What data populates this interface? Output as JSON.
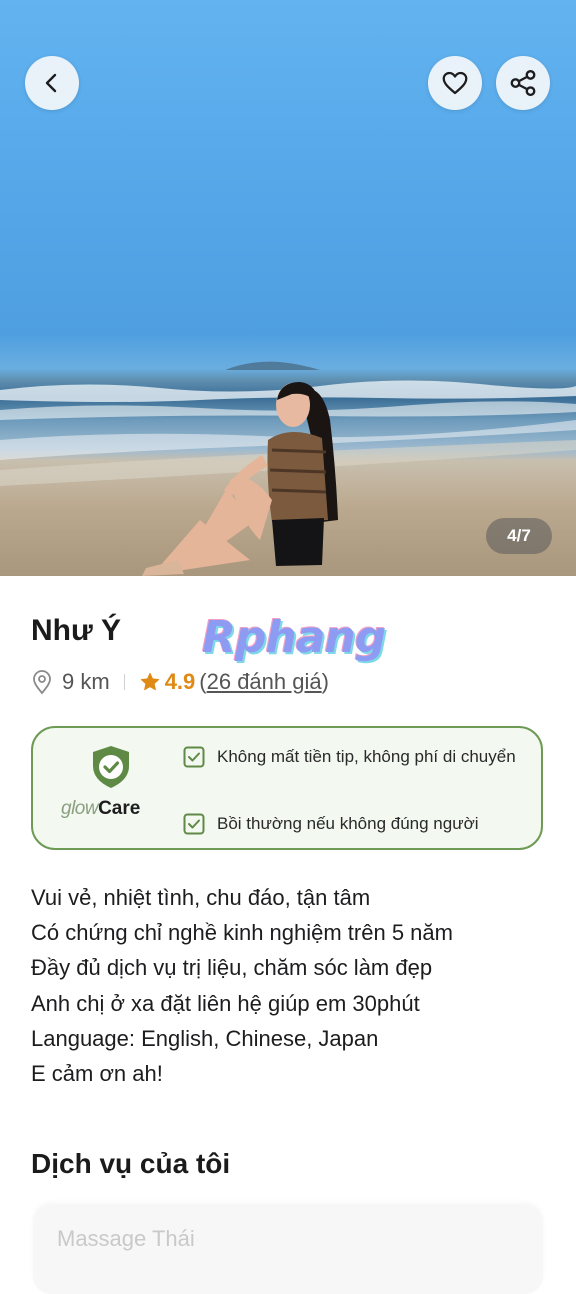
{
  "hero": {
    "photo_counter": "4/7"
  },
  "profile": {
    "name": "Như Ý",
    "watermark": "Rphang",
    "distance": "9 km",
    "rating": "4.9",
    "reviews_open": "(",
    "reviews_link": "26 đánh giá",
    "reviews_close": ")"
  },
  "care": {
    "brand_glow": "glow",
    "brand_care": "Care",
    "items": [
      "Không mất tiền tip, không phí di chuyển",
      "Bồi thường nếu không đúng người"
    ]
  },
  "bio": [
    "Vui vẻ, nhiệt tình, chu đáo, tận tâm",
    "Có chứng chỉ nghề kinh nghiệm trên 5 năm",
    "Đầy đủ dịch vụ trị liệu, chăm sóc làm đẹp",
    "Anh chị ở xa đặt liên hệ giúp em 30phút",
    "Language: English, Chinese, Japan",
    "E cảm ơn ah!"
  ],
  "services": {
    "title": "Dịch vụ của tôi",
    "first_service": "Massage Thái"
  },
  "colors": {
    "accent_rating": "#e08a16",
    "care_border": "#6d9a55",
    "care_shield": "#5e8a45"
  },
  "icons": [
    "back-arrow-icon",
    "heart-icon",
    "share-icon",
    "location-pin-icon",
    "star-icon",
    "shield-check-icon",
    "checkbox-icon"
  ]
}
